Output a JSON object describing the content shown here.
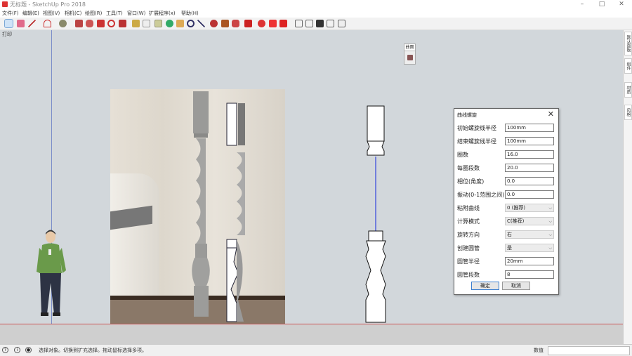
{
  "window": {
    "title": "无标题 - SketchUp Pro 2018",
    "min": "–",
    "max": "□",
    "close": "✕"
  },
  "menu": [
    "文件(F)",
    "编辑(E)",
    "视图(V)",
    "相机(C)",
    "绘图(R)",
    "工具(T)",
    "窗口(W)",
    "扩展程序(x)",
    "帮助(H)"
  ],
  "toolbar_icons": [
    "select-icon",
    "eraser-icon",
    "line-icon",
    "arc-icon",
    "shape-icon",
    "push-pull-icon",
    "follow-me-icon",
    "move-icon",
    "rotate-icon",
    "scale-icon",
    "tape-icon",
    "text-icon",
    "orbit-icon",
    "pan-icon",
    "zoom-icon",
    "zoom-extents-icon",
    "warehouse-icon",
    "extension-icon",
    "ruby-icon",
    "component-icon",
    "material-icon",
    "layout-icon",
    "section-icon",
    "front-icon",
    "top-icon",
    "print-icon"
  ],
  "scene": {
    "label": "打印"
  },
  "toolbox_small": {
    "title": "曲面"
  },
  "right_tabs": [
    "默认面板",
    "组件",
    "材质",
    "风格"
  ],
  "dialog": {
    "title": "曲线螺旋",
    "fields": [
      {
        "label": "初始螺旋线半径",
        "value": "100mm",
        "type": "input"
      },
      {
        "label": "结束螺旋线半径",
        "value": "100mm",
        "type": "input"
      },
      {
        "label": "圈数",
        "value": "16.0",
        "type": "input"
      },
      {
        "label": "每圈段数",
        "value": "20.0",
        "type": "input"
      },
      {
        "label": "相位(角度)",
        "value": "0.0",
        "type": "input"
      },
      {
        "label": "振动(0-1范围之间)",
        "value": "0.0",
        "type": "input"
      },
      {
        "label": "粘附曲线",
        "value": "0 (推荐)",
        "type": "select"
      },
      {
        "label": "计算模式",
        "value": "C(推荐)",
        "type": "select"
      },
      {
        "label": "旋转方向",
        "value": "右",
        "type": "select"
      },
      {
        "label": "创建圆管",
        "value": "是",
        "type": "select"
      },
      {
        "label": "圆管半径",
        "value": "20mm",
        "type": "input"
      },
      {
        "label": "圆管段数",
        "value": "8",
        "type": "input"
      }
    ],
    "ok": "确定",
    "cancel": "取消"
  },
  "status": {
    "text": "选择对象。切换到扩充选择。拖动鼠标选择多项。",
    "measure_label": "数值",
    "measure_value": ""
  },
  "colors": {
    "accent": "#d33333",
    "viewport_bg": "#d2d7db",
    "axis_blue": "#7b8ec9",
    "axis_red": "#cc5555"
  }
}
